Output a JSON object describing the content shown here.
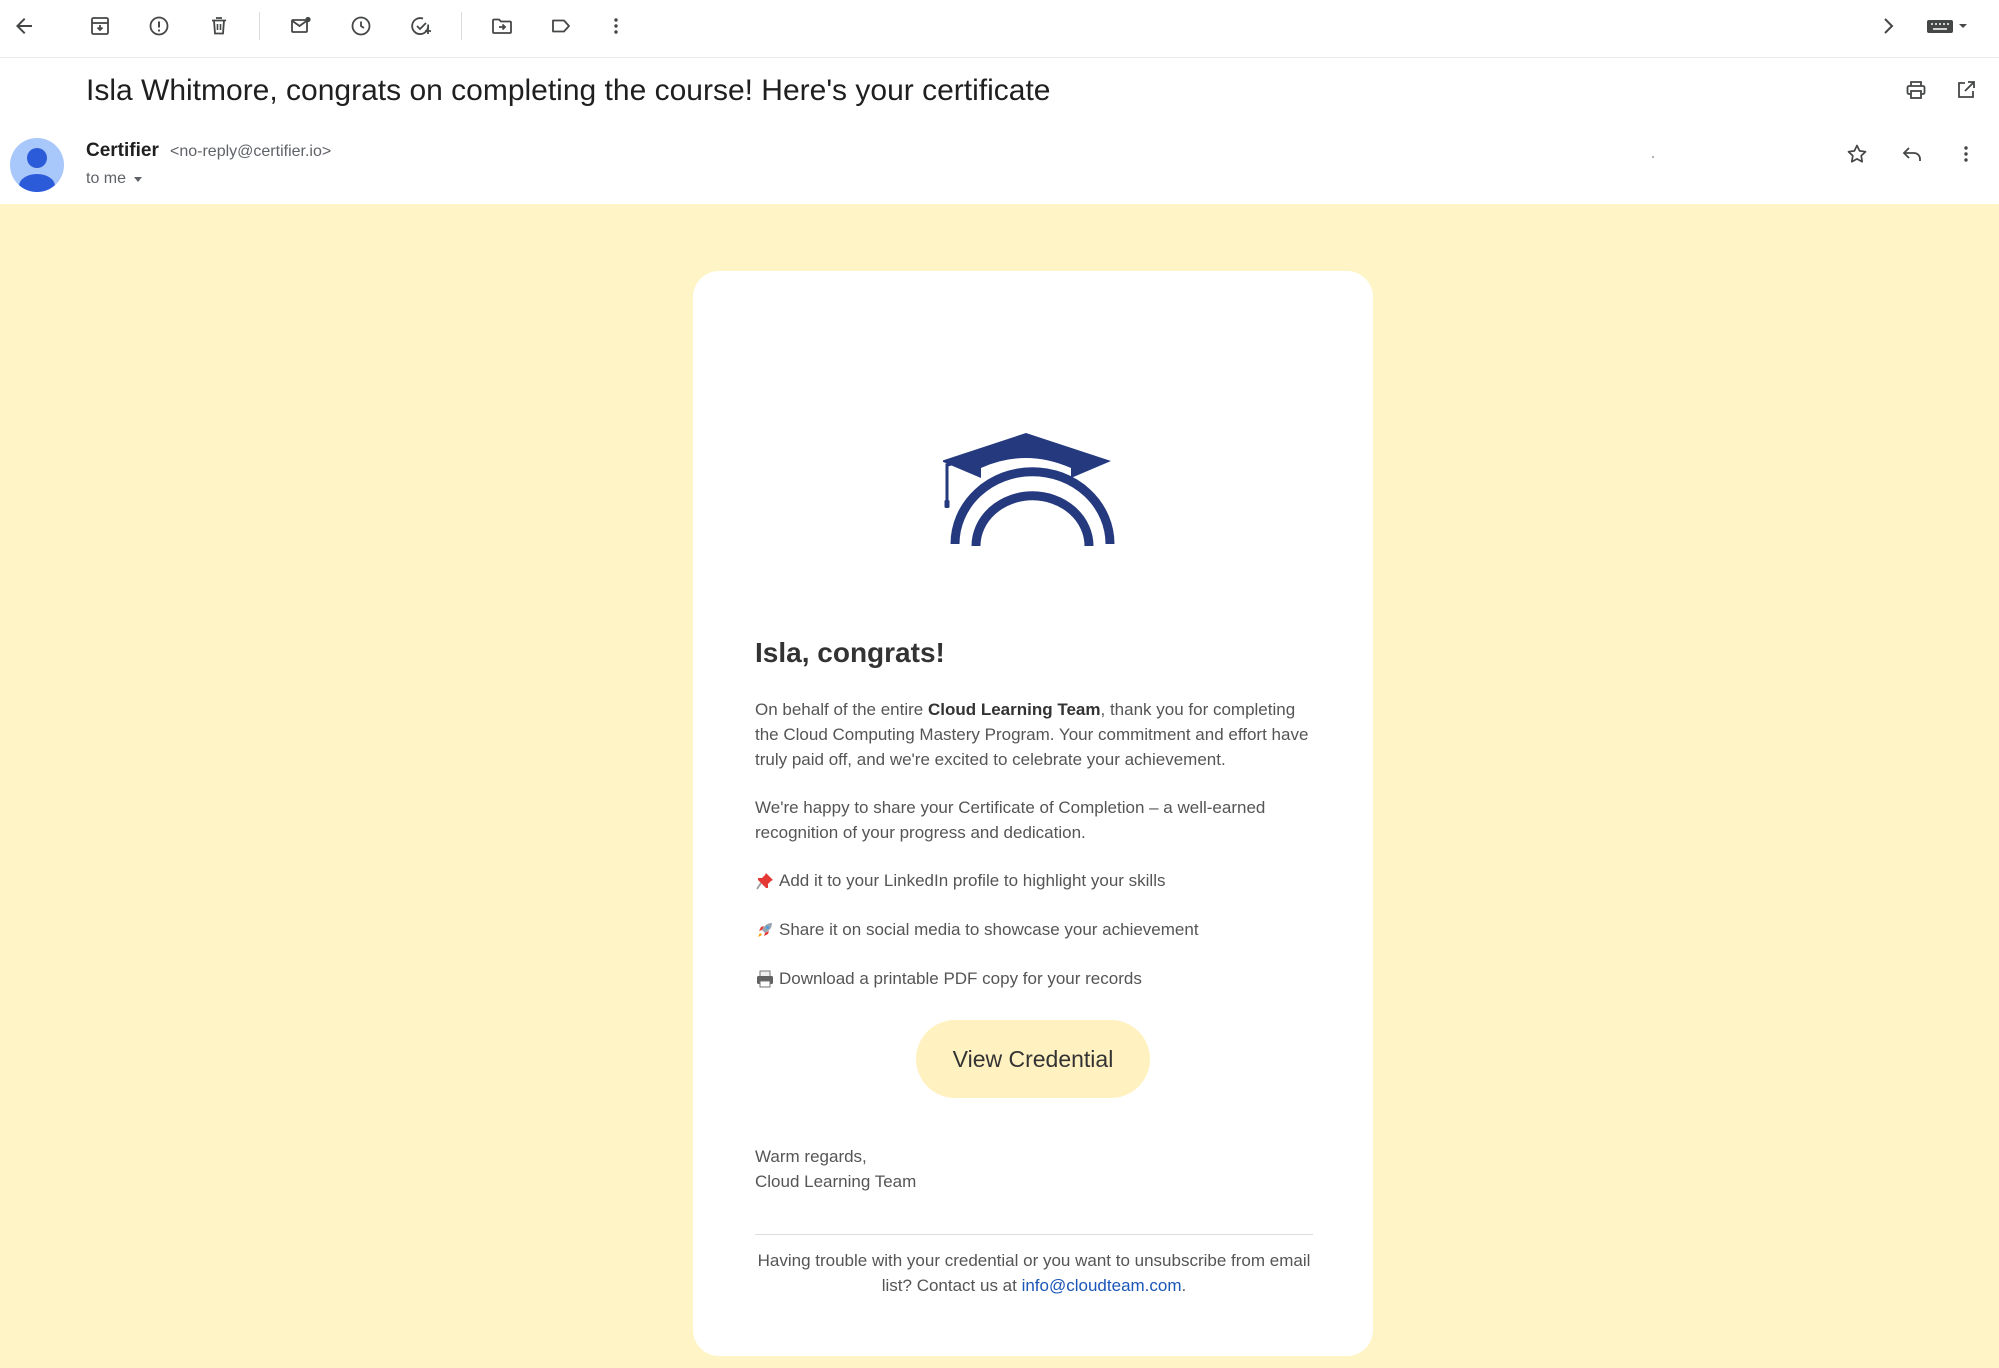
{
  "toolbar": {
    "icons": [
      "back-arrow-icon",
      "archive-icon",
      "report-spam-icon",
      "delete-icon",
      "mark-unread-icon",
      "snooze-icon",
      "add-task-icon",
      "move-to-icon",
      "label-icon",
      "more-vert-icon",
      "next-icon",
      "keyboard-icon"
    ]
  },
  "email": {
    "subject": "Isla Whitmore, congrats on completing the course! Here's your certificate",
    "sender_name": "Certifier",
    "sender_email": "<no-reply@certifier.io>",
    "recipient": "to me"
  },
  "content": {
    "greeting": "Isla, congrats!",
    "para1_before": "On behalf of the entire ",
    "para1_bold": "Cloud Learning Team",
    "para1_after": ", thank you for completing the Cloud Computing Mastery Program. Your commitment and effort have truly paid off, and we're excited to celebrate your achievement.",
    "para2": "We're happy to share your Certificate of Completion – a well-earned recognition of your progress and dedication.",
    "bullets": [
      {
        "icon": "pushpin-icon",
        "text": "Add it to your LinkedIn profile to highlight your skills"
      },
      {
        "icon": "rocket-icon",
        "text": "Share it on social media to showcase your achievement"
      },
      {
        "icon": "printer-icon",
        "text": "Download a printable PDF copy for your records"
      }
    ],
    "cta_label": "View Credential",
    "regards_line1": "Warm regards,",
    "regards_line2": "Cloud Learning Team",
    "footer_text": "Having trouble with your credential or you want to unsubscribe from email list? Contact us at ",
    "footer_link": "info@cloudteam.com",
    "footer_end": "."
  },
  "colors": {
    "body_bg": "#fff4c5",
    "button_bg": "#fff1c0",
    "logo_navy": "#25397f",
    "link": "#1a56b8"
  }
}
